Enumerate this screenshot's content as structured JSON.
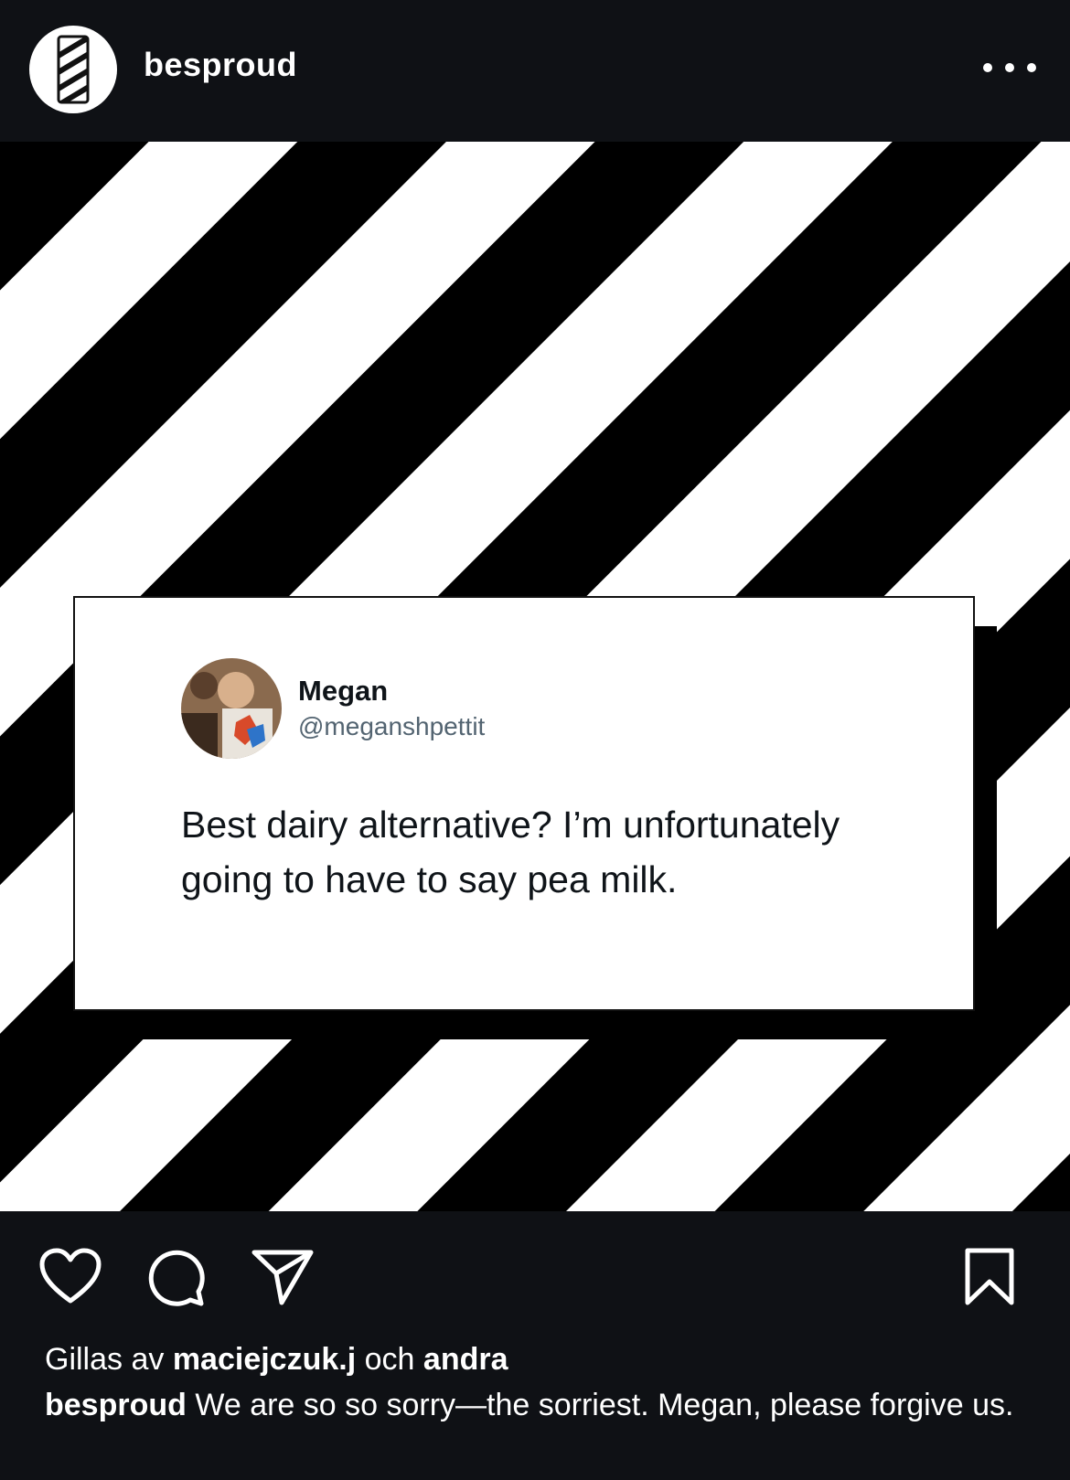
{
  "header": {
    "username": "besproud",
    "avatar_icon": "striped-carton-logo-icon",
    "more_icon": "more-dots-icon"
  },
  "tweet": {
    "name": "Megan",
    "handle": "@meganshpettit",
    "text": "Best dairy alternative? I’m unfortunately going to have to say pea milk."
  },
  "actions": {
    "like_icon": "heart-icon",
    "comment_icon": "comment-icon",
    "share_icon": "send-icon",
    "save_icon": "bookmark-icon"
  },
  "likes": {
    "prefix": "Gillas av",
    "user": "maciejczuk.j",
    "connector": "och",
    "others": "andra"
  },
  "caption": {
    "user": "besproud",
    "text": "We are so so sorry—the sorriest. Megan, please forgive us."
  },
  "colors": {
    "background": "#0f1115",
    "stripe_black": "#000000",
    "stripe_white": "#ffffff"
  }
}
